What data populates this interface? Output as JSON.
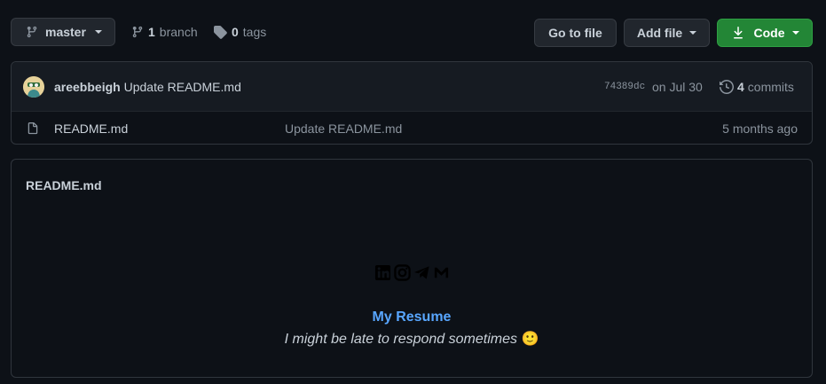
{
  "toolbar": {
    "branch_selector": "master",
    "branch_count": "1",
    "branch_label": "branch",
    "tag_count": "0",
    "tag_label": "tags",
    "go_to_file": "Go to file",
    "add_file": "Add file",
    "code": "Code"
  },
  "commit": {
    "author": "areebbeigh",
    "message": "Update README.md",
    "sha": "74389dc",
    "date": "on Jul 30",
    "commit_count": "4",
    "commit_label": "commits"
  },
  "files": [
    {
      "name": "README.md",
      "message": "Update README.md",
      "age": "5 months ago"
    }
  ],
  "readme": {
    "title": "README.md",
    "link": "My Resume",
    "note": "I might be late to respond sometimes",
    "emoji": "🙂"
  },
  "icons": [
    "git-branch-icon",
    "tag-icon",
    "download-icon",
    "history-icon",
    "file-icon",
    "linkedin-icon",
    "instagram-icon",
    "telegram-icon",
    "gmail-icon"
  ],
  "colors": {
    "background": "#0d1117",
    "border": "#30363d",
    "button": "#21262d",
    "primary_button": "#238636",
    "link": "#58a6ff",
    "muted": "#8b949e",
    "text": "#c9d1d9"
  }
}
